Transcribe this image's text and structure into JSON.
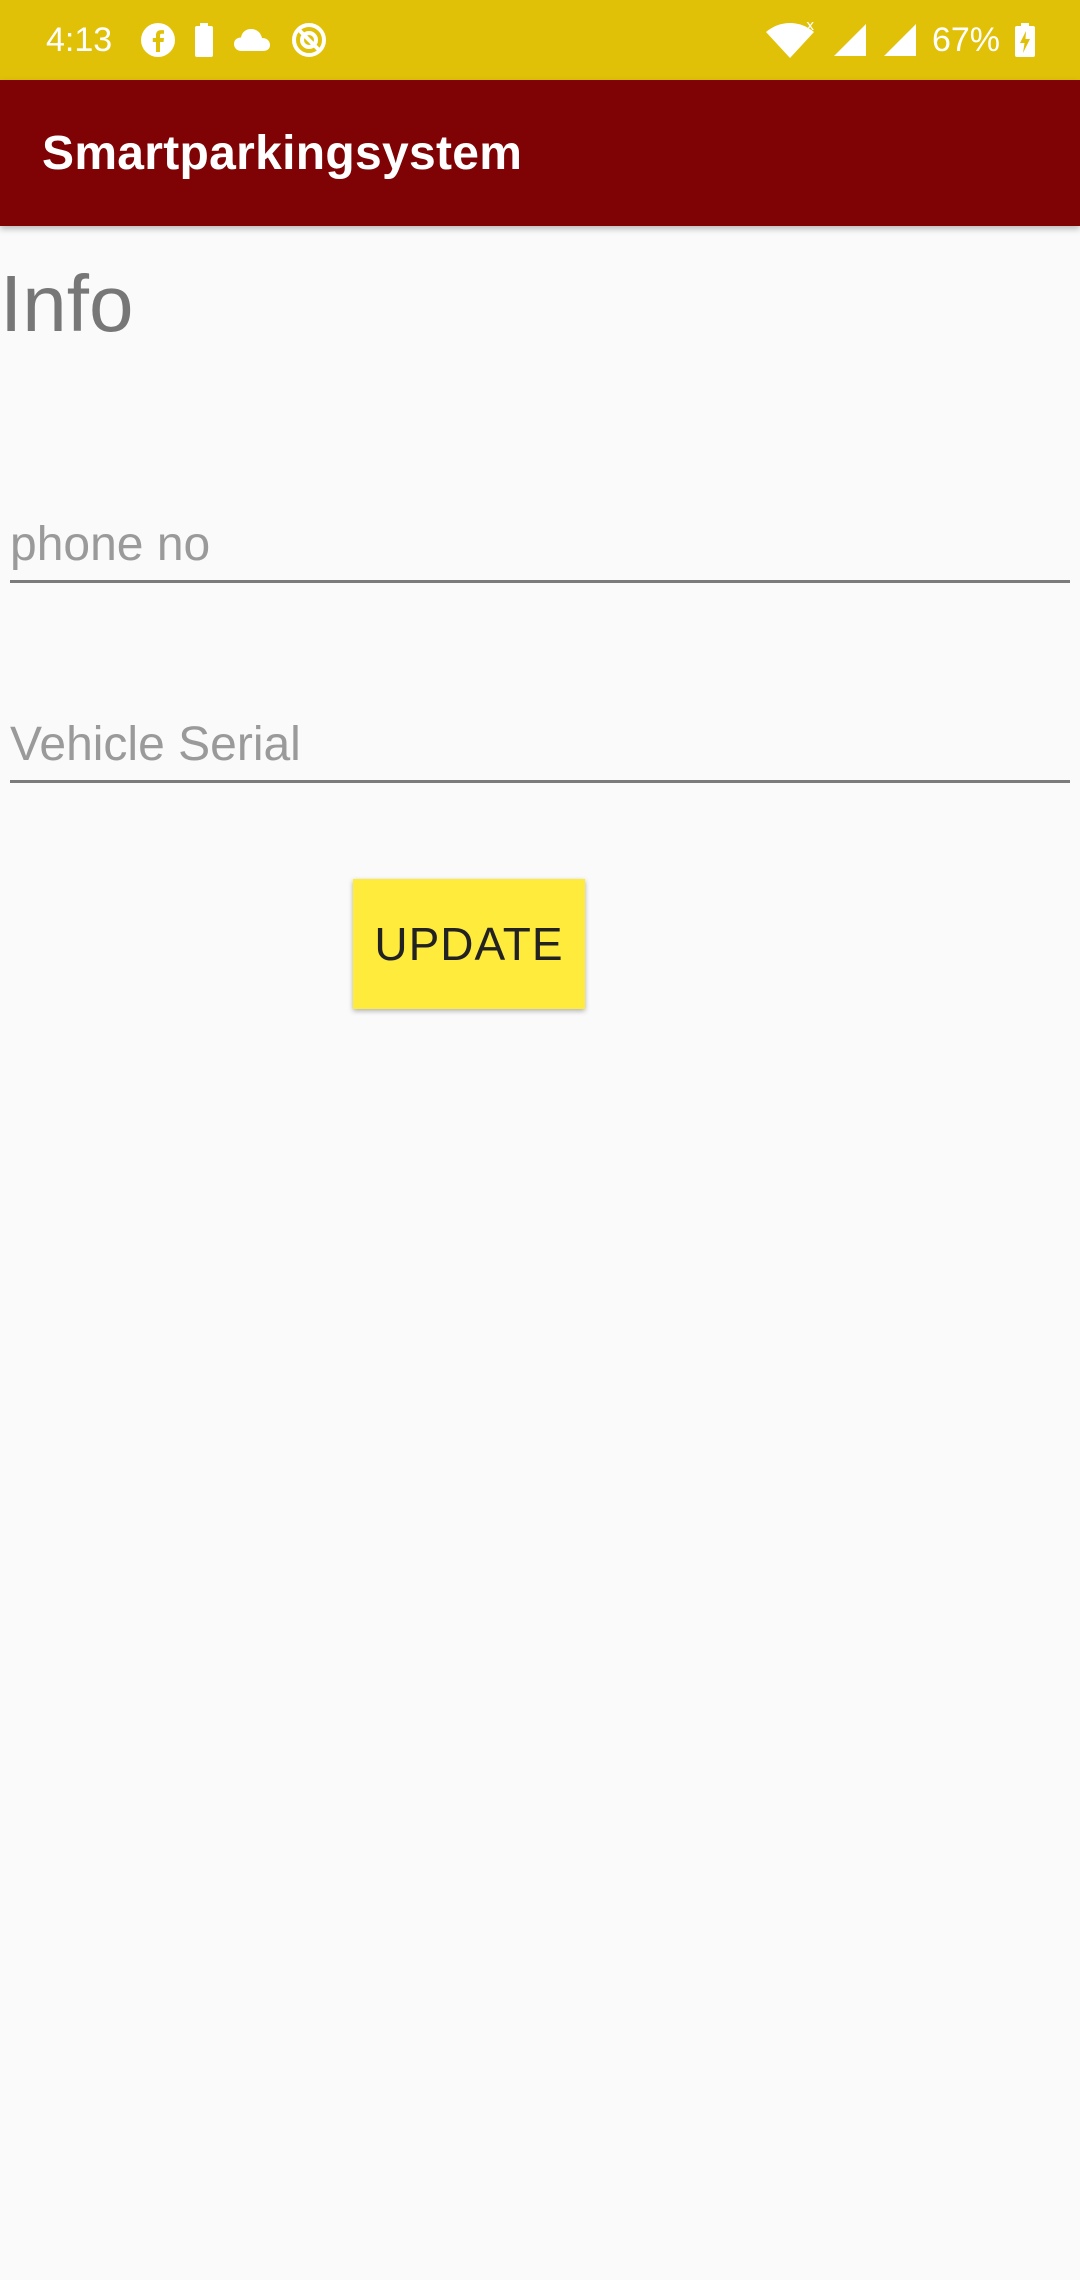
{
  "status_bar": {
    "time": "4:13",
    "battery_percent": "67%",
    "icons_left": [
      "facebook-icon",
      "battery-saver-icon",
      "cloud-icon",
      "sync-disabled-icon"
    ],
    "icons_right": [
      "wifi-icon",
      "mobile-signal-icon",
      "signal-icon",
      "battery-charging-icon"
    ],
    "background_color": "#e1c107"
  },
  "app_bar": {
    "title": "Smartparkingsystem",
    "background_color": "#7f0304"
  },
  "content": {
    "heading": "Info",
    "phone_field": {
      "value": "",
      "placeholder": "phone no"
    },
    "vehicle_field": {
      "value": "",
      "placeholder": "Vehicle Serial"
    },
    "update_button": {
      "label": "UPDATE",
      "color": "#ffeb3b"
    }
  }
}
